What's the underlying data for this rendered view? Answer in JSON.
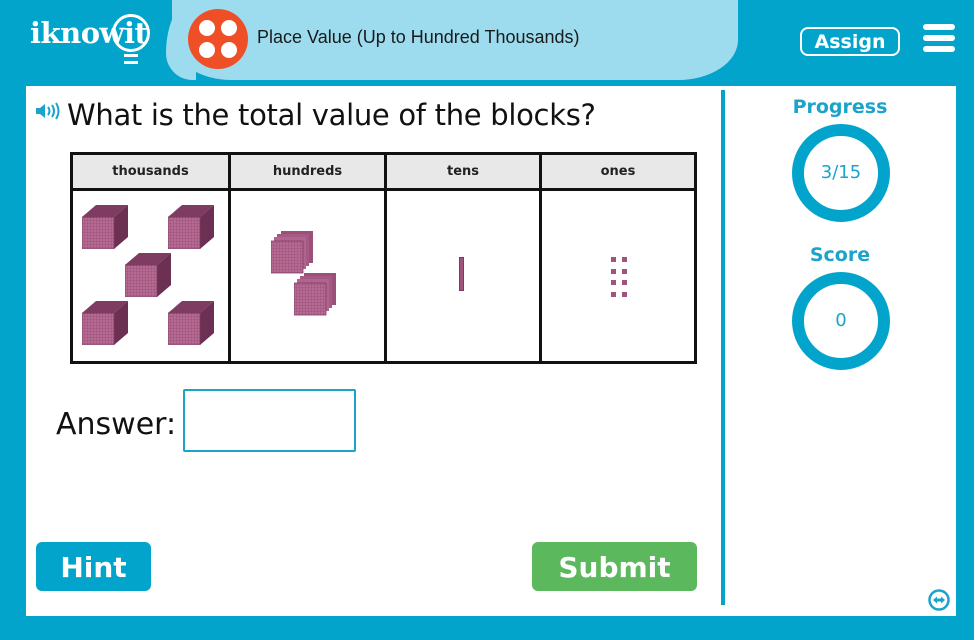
{
  "header": {
    "logo": "iknowit",
    "title": "Place Value (Up to Hundred Thousands)",
    "topic_icon": "four-dots-icon",
    "assign_label": "Assign",
    "menu_icon": "hamburger-menu-icon"
  },
  "question": {
    "speaker_icon": "speaker-icon",
    "text": "What is the total value of the blocks?"
  },
  "place_value_table": {
    "columns": [
      {
        "label": "thousands",
        "block": "thousand-cube",
        "count": 5
      },
      {
        "label": "hundreds",
        "block": "hundred-flat",
        "count": 2
      },
      {
        "label": "tens",
        "block": "ten-rod",
        "count": 1
      },
      {
        "label": "ones",
        "block": "one-unit",
        "count": 8
      }
    ]
  },
  "answer": {
    "label": "Answer:",
    "value": "",
    "placeholder": ""
  },
  "buttons": {
    "hint": "Hint",
    "submit": "Submit"
  },
  "sidebar": {
    "progress_label": "Progress",
    "progress_value": "3/15",
    "score_label": "Score",
    "score_value": "0",
    "expand_icon": "expand-arrows-icon"
  },
  "colors": {
    "brand_blue": "#03a4cc",
    "title_bar": "#9ddcee",
    "topic_orange": "#ef4f27",
    "submit_green": "#5cb85c",
    "block_purple": "#a0547d"
  }
}
